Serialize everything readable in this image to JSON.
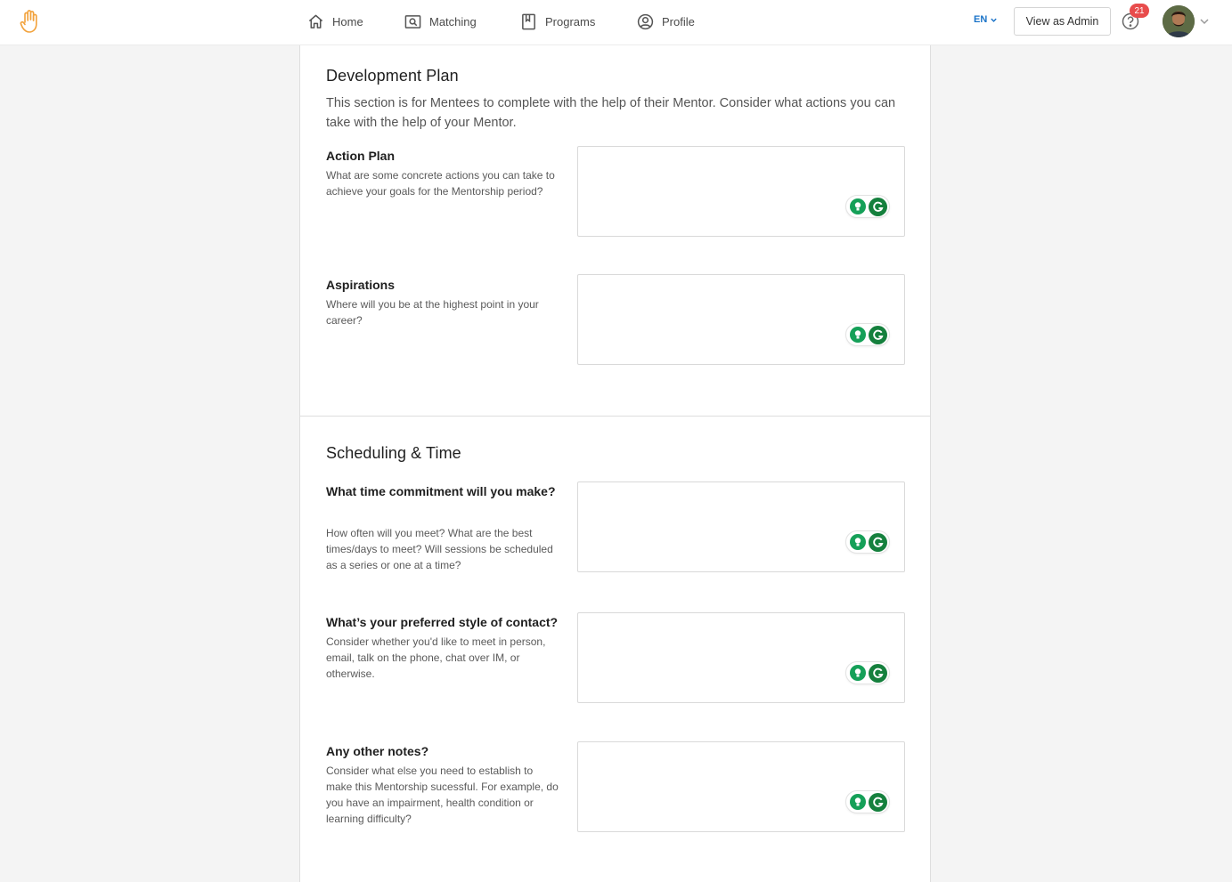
{
  "nav": {
    "items": [
      {
        "label": "Home",
        "icon": "home-icon"
      },
      {
        "label": "Matching",
        "icon": "matching-icon"
      },
      {
        "label": "Programs",
        "icon": "book-icon"
      },
      {
        "label": "Profile",
        "icon": "profile-icon"
      }
    ],
    "language": "EN",
    "admin_button": "View as Admin",
    "notification_count": "21"
  },
  "colors": {
    "accent": "#1a73c8",
    "logo": "#f2a23c",
    "badge": "#e84c4c",
    "grammarly": "#15803d"
  },
  "development": {
    "title": "Development Plan",
    "description": "This section is for Mentees to complete with the help of their Mentor. Consider what actions you can take with the help of your Mentor.",
    "fields": [
      {
        "label": "Action Plan",
        "help": "What are some concrete actions you can take to achieve your goals for the Mentorship period?",
        "value": ""
      },
      {
        "label": "Aspirations",
        "help": "Where will you be at the highest point in your career?",
        "value": ""
      }
    ]
  },
  "scheduling": {
    "title": "Scheduling & Time",
    "fields": [
      {
        "label": "What time commitment will you make?",
        "help": "How often will you meet? What are the best times/days to meet? Will sessions be scheduled as a series or one at a time?",
        "value": ""
      },
      {
        "label": "What’s your preferred style of contact?",
        "help": "Consider whether you'd like to meet in person, email, talk on the phone, chat over IM, or otherwise.",
        "value": ""
      },
      {
        "label": "Any other notes?",
        "help": "Consider what else you need to establish to make this Mentorship sucessful. For example, do you have an impairment, health condition or learning difficulty?",
        "value": ""
      }
    ]
  }
}
